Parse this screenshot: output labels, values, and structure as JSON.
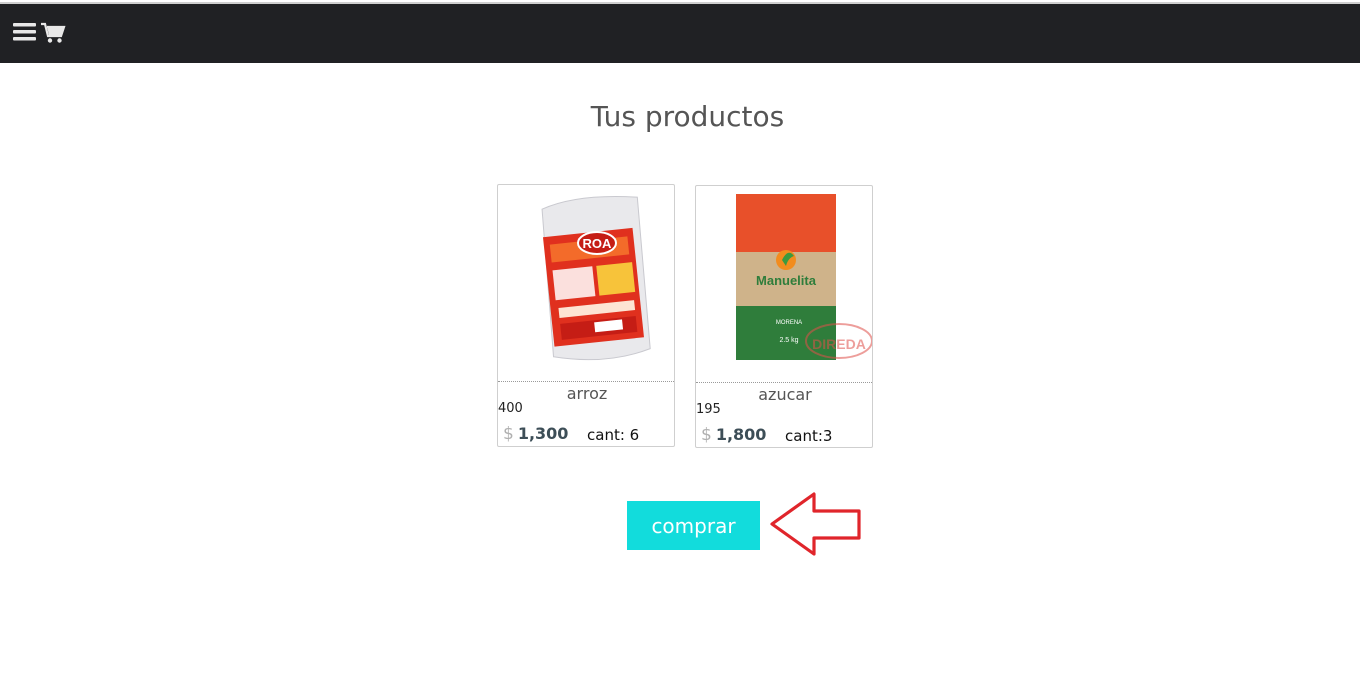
{
  "header": {
    "menu_icon": "hamburger-menu-icon",
    "cart_icon": "shopping-cart-icon",
    "background_color": "#202124"
  },
  "page": {
    "title": "Tus productos"
  },
  "products": [
    {
      "name": "arroz",
      "stock": "400",
      "currency": "$",
      "price": "1,300",
      "quantity": "cant: 6",
      "image_brand": "ROA"
    },
    {
      "name": "azucar",
      "stock": "195",
      "currency": "$",
      "price": "1,800",
      "quantity": "cant:3",
      "image_brand": "Manuelita",
      "image_subtitle": "MORENA",
      "image_weight": "2.5 kg",
      "image_watermark": "DIREDA"
    }
  ],
  "actions": {
    "buy_label": "comprar",
    "buy_color": "#12dcdc",
    "annotation_arrow_color": "#e0252b"
  }
}
